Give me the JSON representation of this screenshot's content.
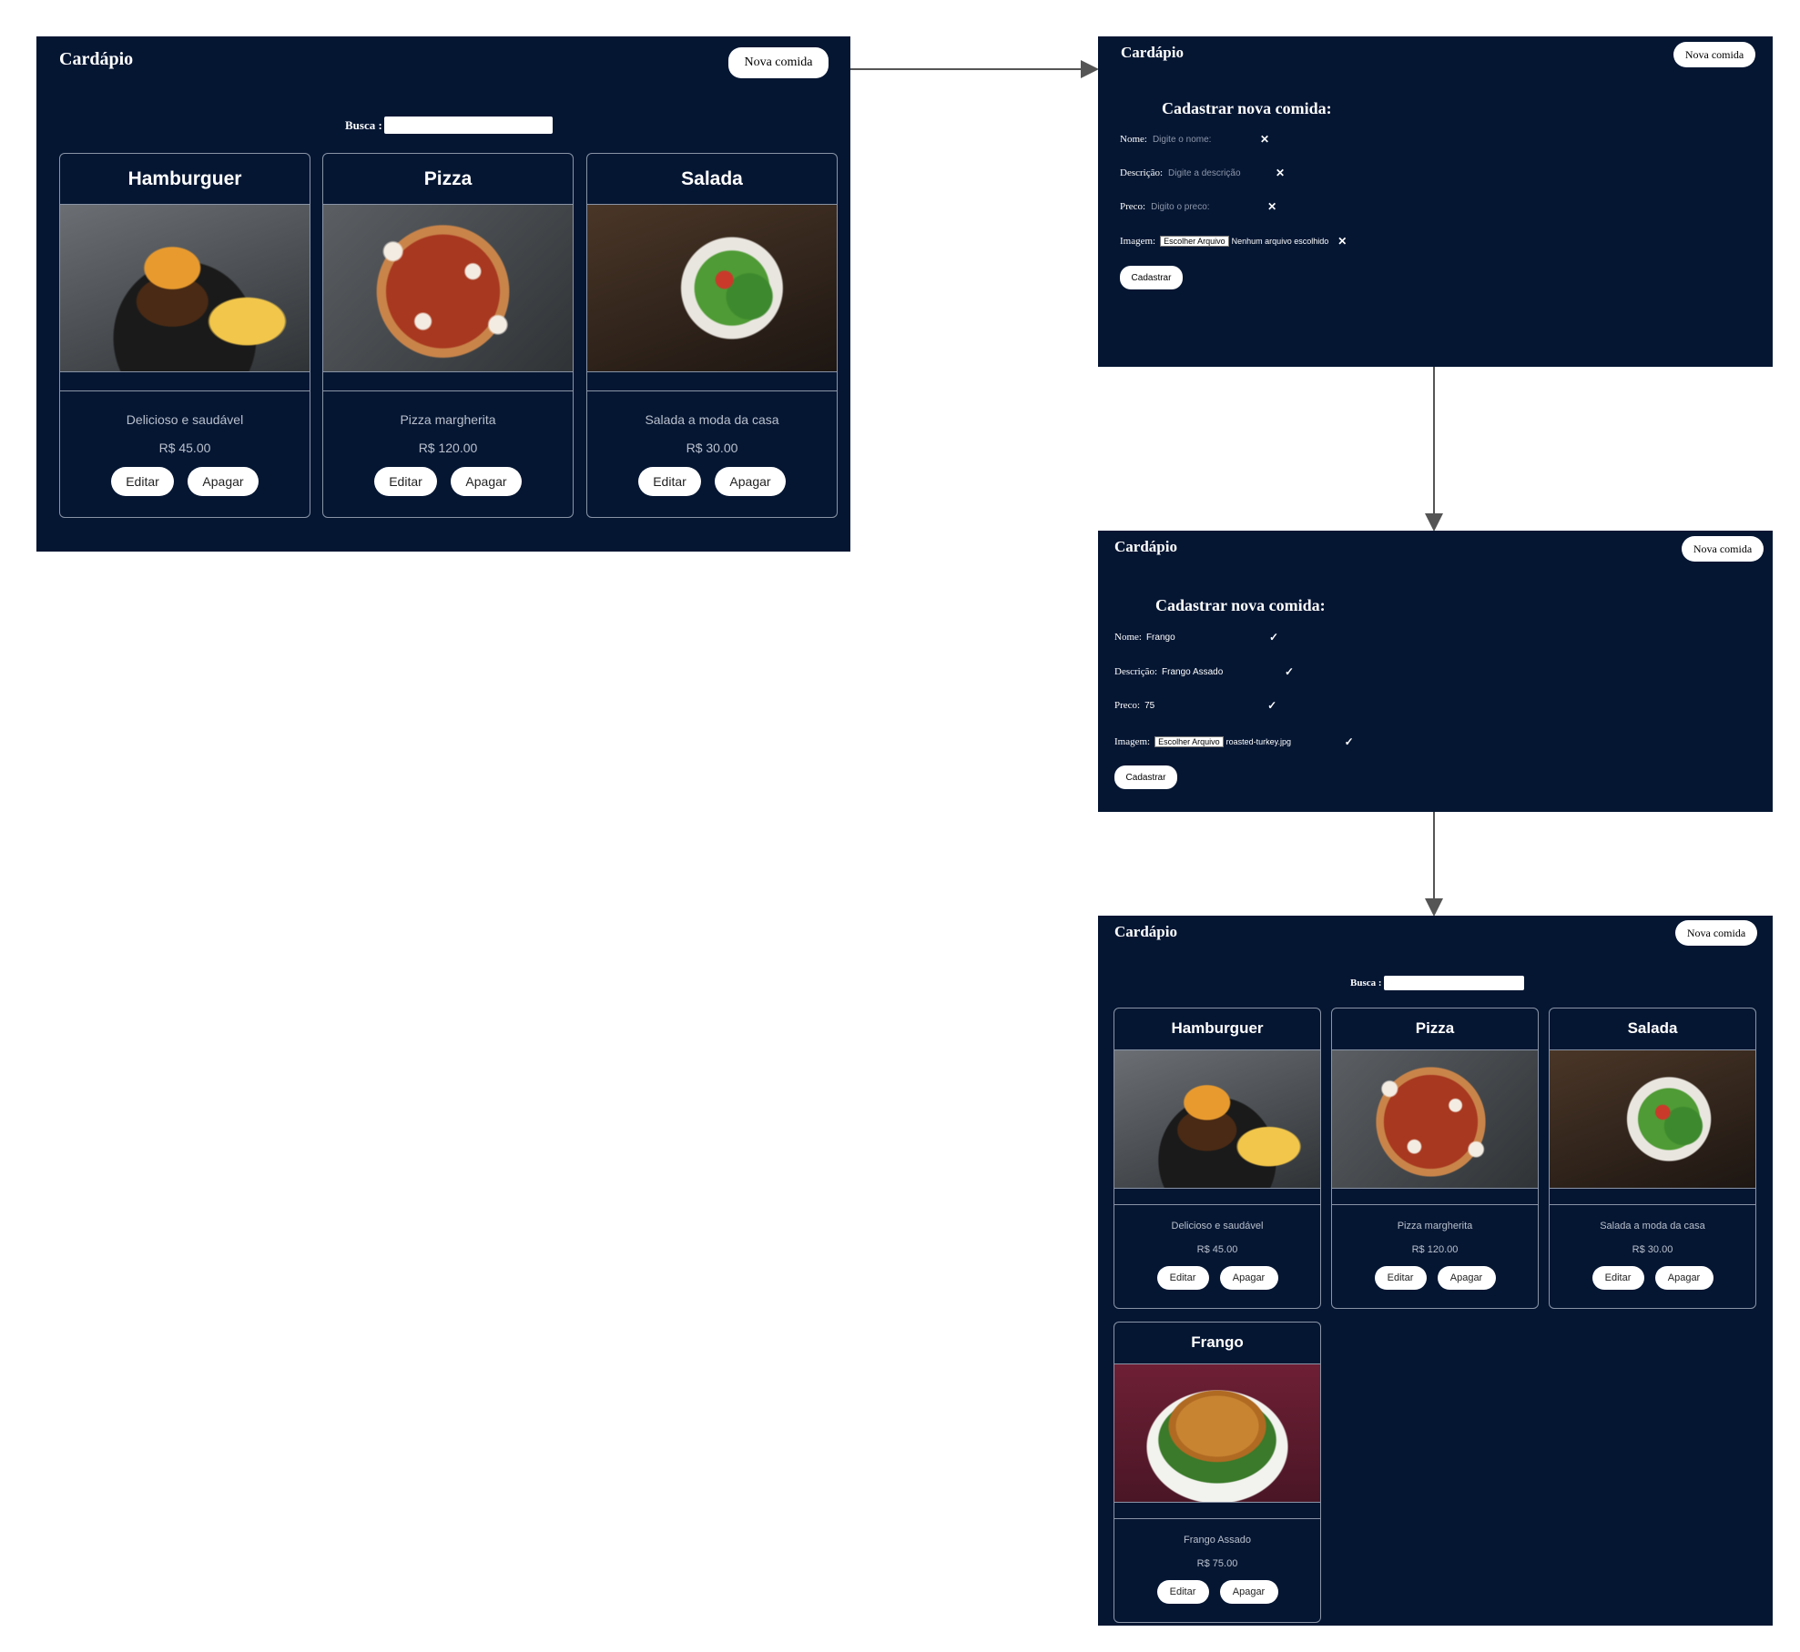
{
  "app": {
    "title": "Cardápio",
    "new_button": "Nova comida",
    "search_label": "Busca :"
  },
  "card_buttons": {
    "edit": "Editar",
    "delete": "Apagar"
  },
  "foods": [
    {
      "name": "Hamburguer",
      "description": "Delicioso e saudável",
      "price": "R$ 45.00",
      "image": "burger"
    },
    {
      "name": "Pizza",
      "description": "Pizza margherita",
      "price": "R$ 120.00",
      "image": "pizza"
    },
    {
      "name": "Salada",
      "description": "Salada a moda da casa",
      "price": "R$ 30.00",
      "image": "salad"
    }
  ],
  "new_food": {
    "name": "Frango",
    "description": "Frango Assado",
    "price": "R$ 75.00",
    "image": "roast-chicken"
  },
  "form": {
    "heading": "Cadastrar nova comida:",
    "name_label": "Nome:",
    "desc_label": "Descrição:",
    "price_label": "Preco:",
    "image_label": "Imagem:",
    "name_placeholder": "Digite o nome:",
    "desc_placeholder": "Digite a descrição",
    "price_placeholder": "Digito o preco:",
    "file_button": "Escolher Arquivo",
    "no_file": "Nenhum arquivo escolhido",
    "submit": "Cadastrar",
    "invalid_mark": "✕",
    "valid_mark": "✓"
  },
  "filled_form": {
    "name": "Frango",
    "description": "Frango Assado",
    "price": "75",
    "file": "roasted-turkey.jpg"
  },
  "colors": {
    "panel_bg": "#051633",
    "border": "#8a94a6",
    "button_bg": "#ffffff",
    "arrow": "#555555"
  }
}
